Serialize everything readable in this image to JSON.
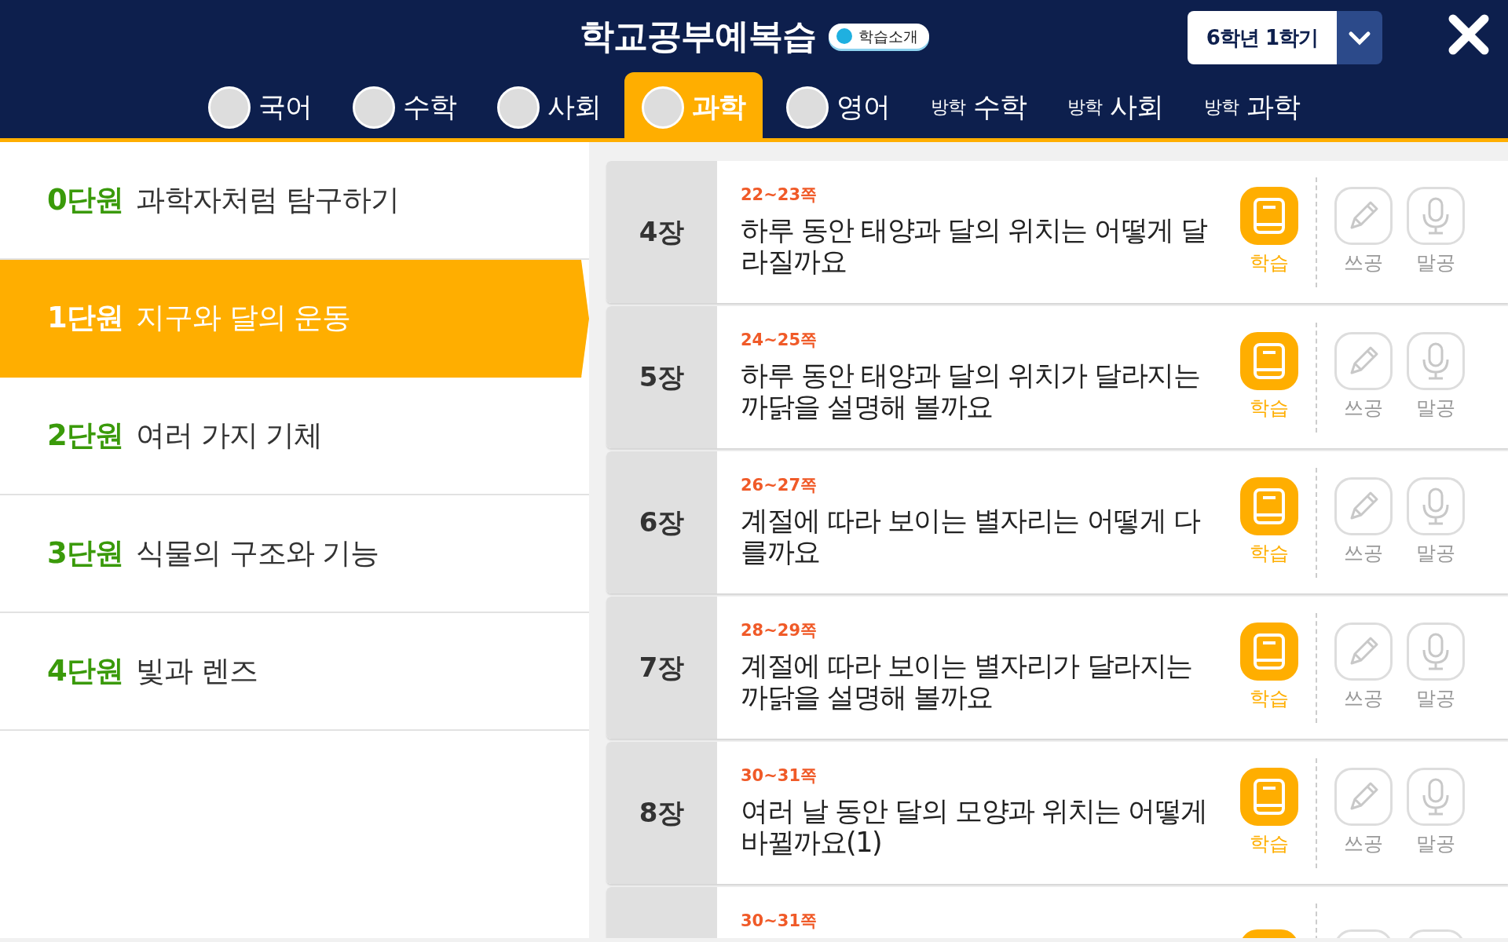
{
  "header": {
    "title": "학교공부예복습",
    "intro_badge": "학습소개",
    "semester": "6학년 1학기"
  },
  "tabs": [
    {
      "kind": "avatar",
      "label": "국어",
      "selected": false
    },
    {
      "kind": "avatar",
      "label": "수학",
      "selected": false
    },
    {
      "kind": "avatar",
      "label": "사회",
      "selected": false
    },
    {
      "kind": "avatar",
      "label": "과학",
      "selected": true
    },
    {
      "kind": "avatar",
      "label": "영어",
      "selected": false
    },
    {
      "kind": "vacation",
      "prefix": "방학",
      "label": "수학",
      "selected": false
    },
    {
      "kind": "vacation",
      "prefix": "방학",
      "label": "사회",
      "selected": false
    },
    {
      "kind": "vacation",
      "prefix": "방학",
      "label": "과학",
      "selected": false
    }
  ],
  "units": [
    {
      "number": "0단원",
      "title": "과학자처럼 탐구하기",
      "selected": false
    },
    {
      "number": "1단원",
      "title": "지구와 달의 운동",
      "selected": true
    },
    {
      "number": "2단원",
      "title": "여러 가지 기체",
      "selected": false
    },
    {
      "number": "3단원",
      "title": "식물의 구조와 기능",
      "selected": false
    },
    {
      "number": "4단원",
      "title": "빛과 렌즈",
      "selected": false
    }
  ],
  "lessons": [
    {
      "chapter": "4장",
      "pages": "22~23쪽",
      "title": "하루 동안 태양과 달의 위치는 어떻게 달라질까요",
      "actions": [
        {
          "kind": "study",
          "label": "학습",
          "active": true
        },
        {
          "kind": "write",
          "label": "쓰공",
          "active": false
        },
        {
          "kind": "speak",
          "label": "말공",
          "active": false
        }
      ]
    },
    {
      "chapter": "5장",
      "pages": "24~25쪽",
      "title": "하루 동안 태양과 달의 위치가 달라지는 까닭을 설명해 볼까요",
      "actions": [
        {
          "kind": "study",
          "label": "학습",
          "active": true
        },
        {
          "kind": "write",
          "label": "쓰공",
          "active": false
        },
        {
          "kind": "speak",
          "label": "말공",
          "active": false
        }
      ]
    },
    {
      "chapter": "6장",
      "pages": "26~27쪽",
      "title": "계절에 따라 보이는 별자리는 어떻게 다를까요",
      "actions": [
        {
          "kind": "study",
          "label": "학습",
          "active": true
        },
        {
          "kind": "write",
          "label": "쓰공",
          "active": false
        },
        {
          "kind": "speak",
          "label": "말공",
          "active": false
        }
      ]
    },
    {
      "chapter": "7장",
      "pages": "28~29쪽",
      "title": "계절에 따라 보이는 별자리가 달라지는 까닭을 설명해 볼까요",
      "actions": [
        {
          "kind": "study",
          "label": "학습",
          "active": true
        },
        {
          "kind": "write",
          "label": "쓰공",
          "active": false
        },
        {
          "kind": "speak",
          "label": "말공",
          "active": false
        }
      ]
    },
    {
      "chapter": "8장",
      "pages": "30~31쪽",
      "title": "여러 날 동안 달의 모양과 위치는 어떻게 바뀔까요(1)",
      "actions": [
        {
          "kind": "study",
          "label": "학습",
          "active": true
        },
        {
          "kind": "write",
          "label": "쓰공",
          "active": false
        },
        {
          "kind": "speak",
          "label": "말공",
          "active": false
        }
      ]
    },
    {
      "pages": "30~31쪽",
      "actions": [
        {
          "kind": "study",
          "active": true
        },
        {
          "kind": "write",
          "active": false
        },
        {
          "kind": "speak",
          "active": false
        }
      ]
    }
  ]
}
